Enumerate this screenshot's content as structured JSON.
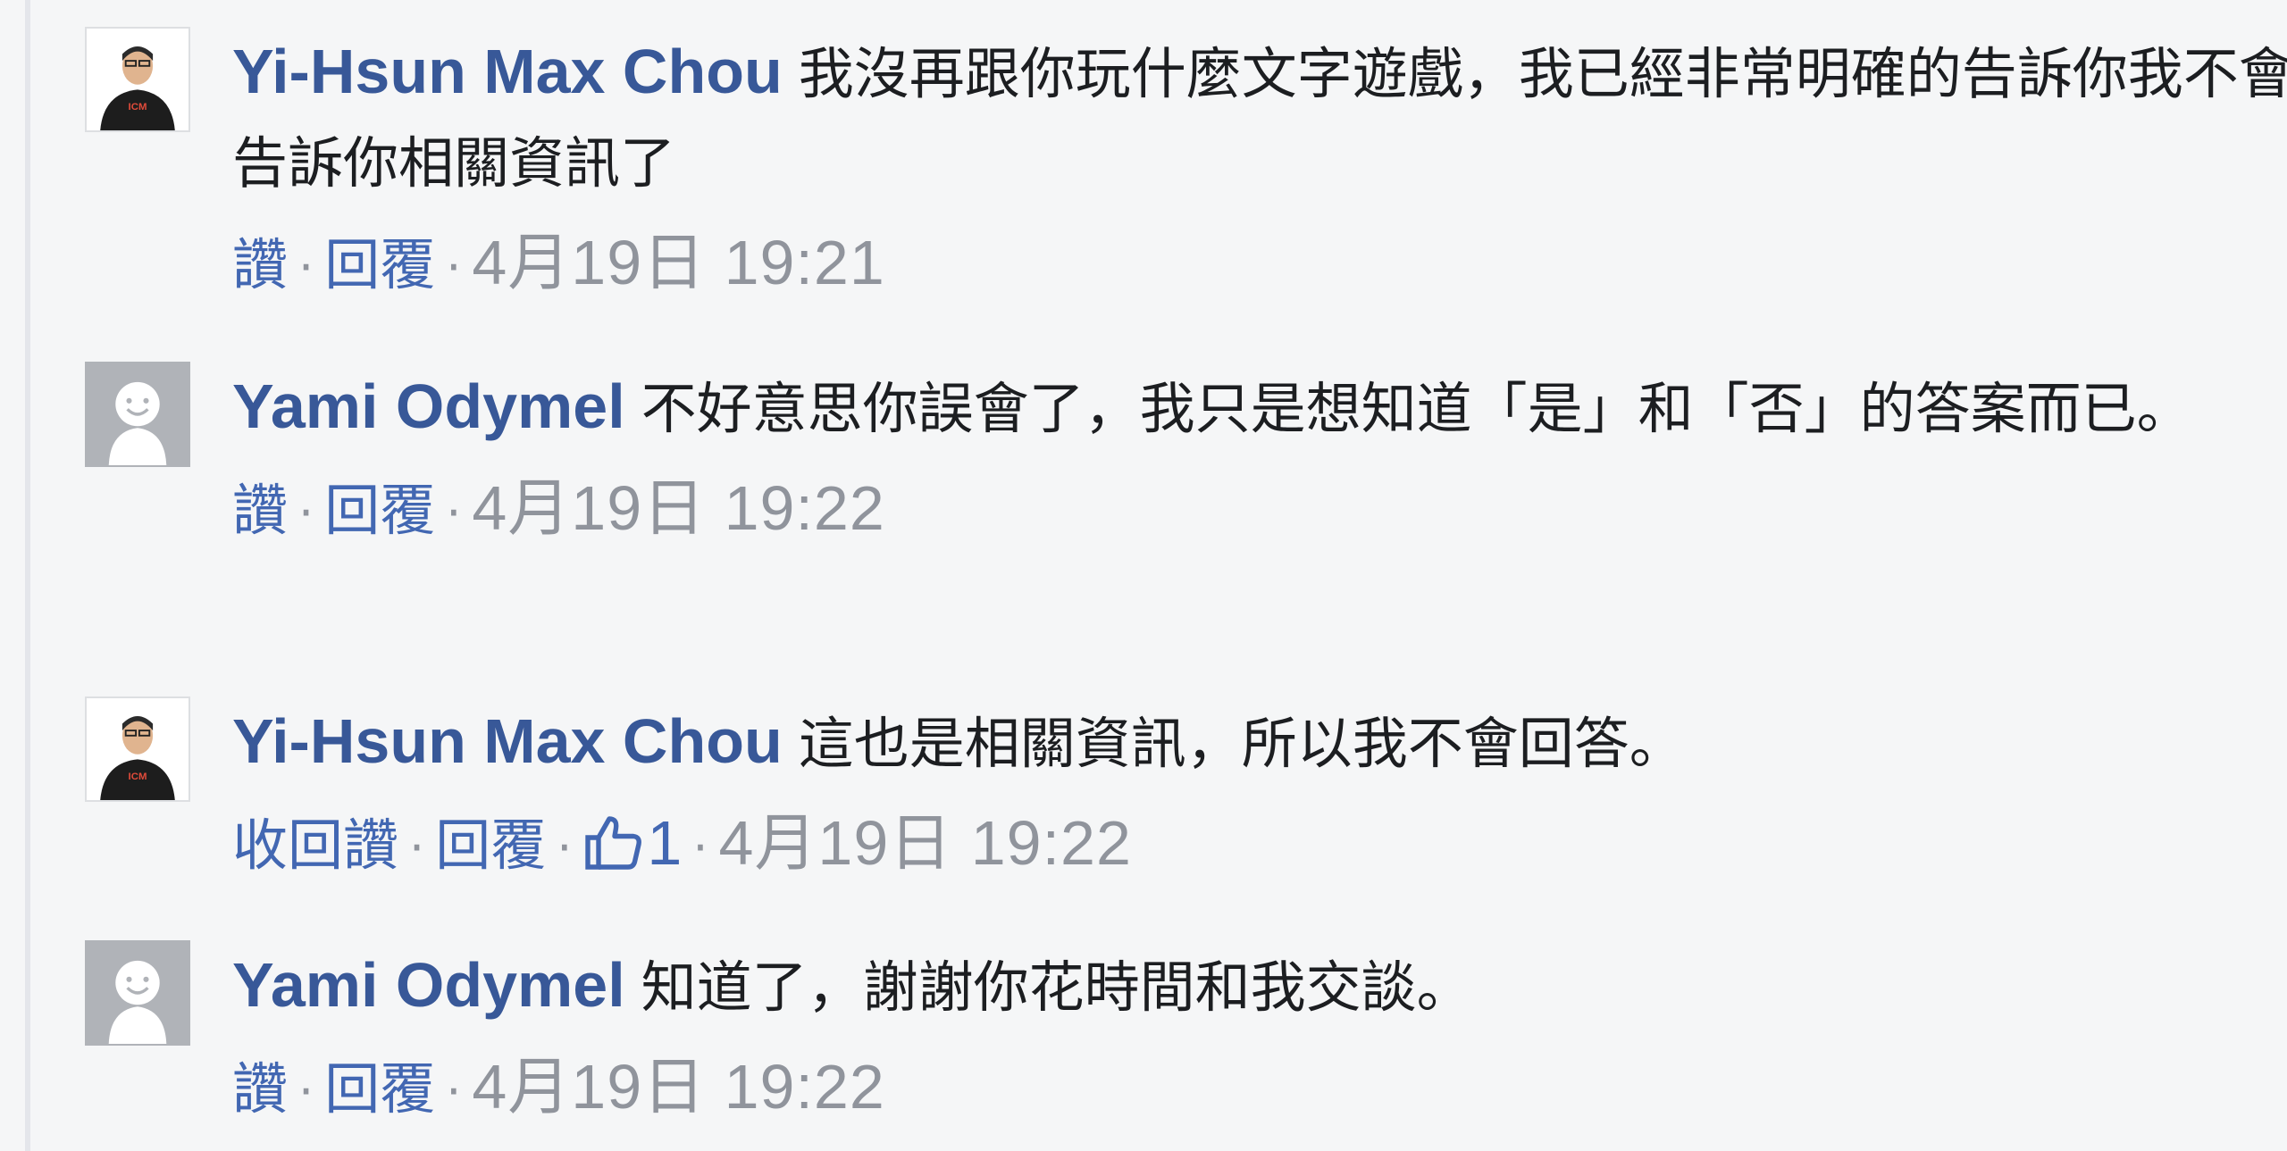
{
  "comments": [
    {
      "author": "Yi-Hsun Max Chou",
      "avatar": "profile-photo",
      "text": "我沒再跟你玩什麼文字遊戲，我已經非常明確的告訴你我不會告訴你相關資訊了",
      "like_label": "讚",
      "reply_label": "回覆",
      "timestamp": "4月19日 19:21"
    },
    {
      "author": "Yami Odymel",
      "avatar": "default-avatar",
      "text": "不好意思你誤會了，我只是想知道「是」和「否」的答案而已。",
      "like_label": "讚",
      "reply_label": "回覆",
      "timestamp": "4月19日 19:22"
    },
    {
      "author": "Yi-Hsun Max Chou",
      "avatar": "profile-photo",
      "text": "這也是相關資訊，所以我不會回答。",
      "like_label": "收回讚",
      "reply_label": "回覆",
      "like_count": "1",
      "like_icon": "thumbs-up-icon",
      "timestamp": "4月19日 19:22"
    },
    {
      "author": "Yami Odymel",
      "avatar": "default-avatar",
      "text": "知道了，謝謝你花時間和我交談。",
      "like_label": "讚",
      "reply_label": "回覆",
      "timestamp": "4月19日 19:22"
    }
  ],
  "separator": "·",
  "colors": {
    "author": "#385898",
    "action_link": "#4267b2",
    "meta": "#90949c",
    "text": "#1c1e21",
    "background": "#f5f6f7"
  }
}
